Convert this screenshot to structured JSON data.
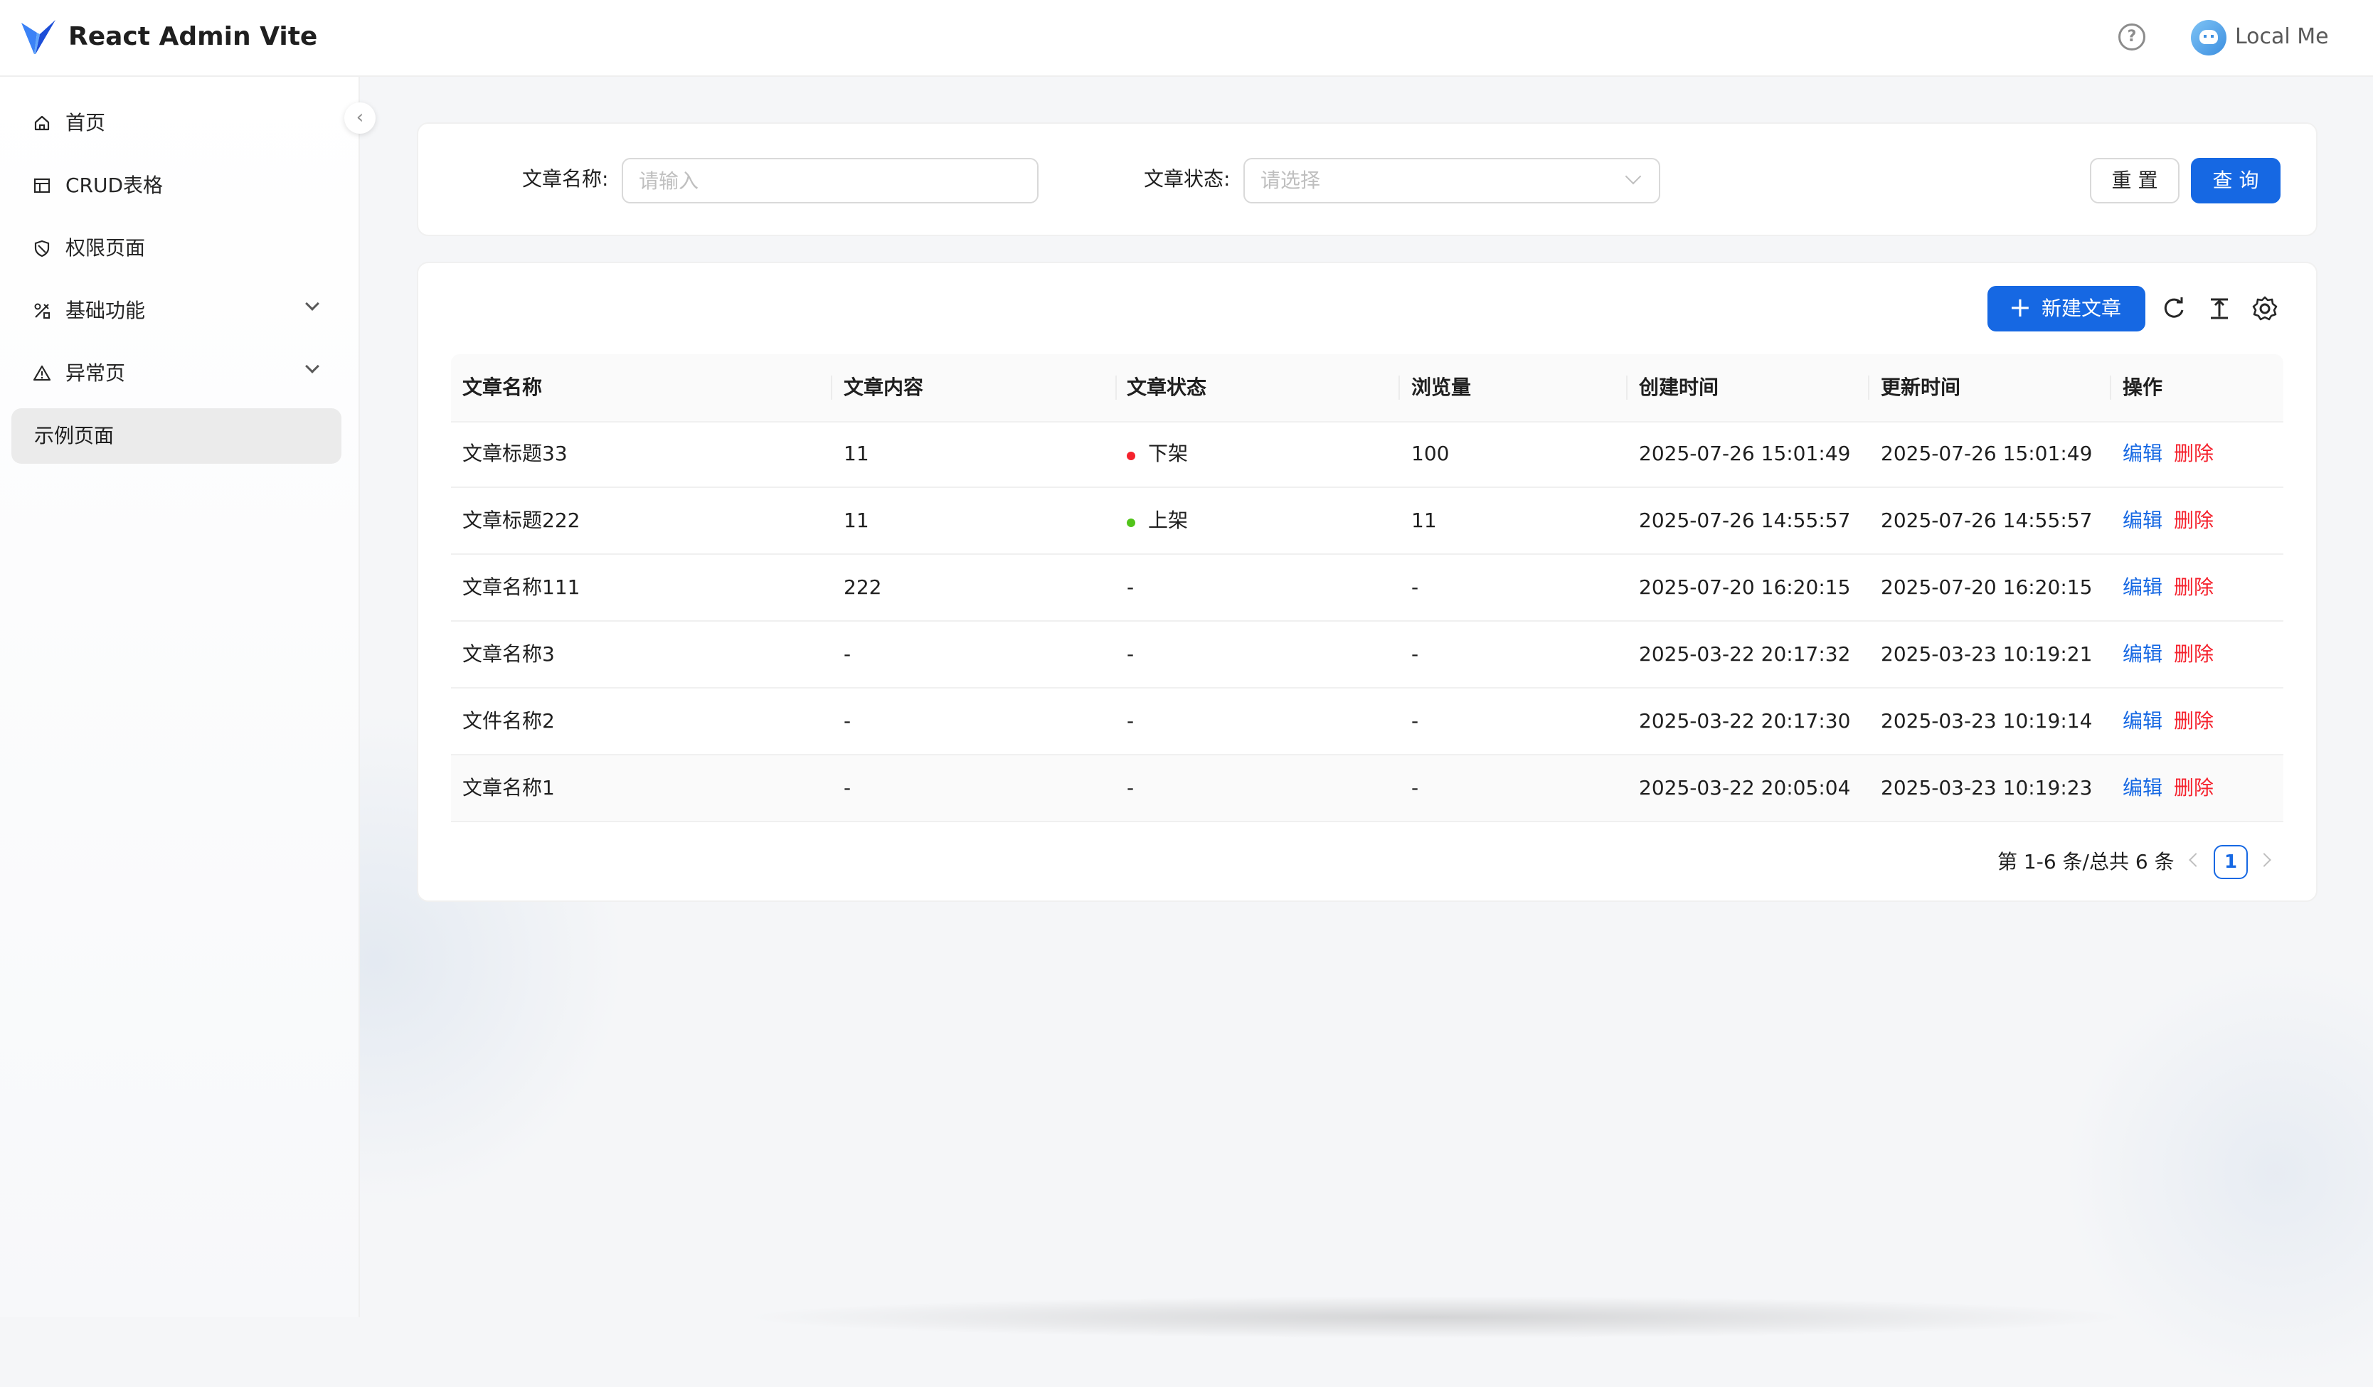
{
  "header": {
    "app_title": "React Admin Vite",
    "user_name": "Local Me",
    "help_icon": "?"
  },
  "sidebar": {
    "collapse_icon": "‹",
    "items": [
      {
        "label": "首页",
        "icon": "home-icon"
      },
      {
        "label": "CRUD表格",
        "icon": "table-icon"
      },
      {
        "label": "权限页面",
        "icon": "shield-icon"
      },
      {
        "label": "基础功能",
        "icon": "tools-icon",
        "expandable": true
      },
      {
        "label": "异常页",
        "icon": "warning-icon",
        "expandable": true
      },
      {
        "label": "示例页面",
        "active": true
      }
    ]
  },
  "search": {
    "name_label": "文章名称:",
    "name_placeholder": "请输入",
    "status_label": "文章状态:",
    "status_placeholder": "请选择",
    "reset_label": "重 置",
    "query_label": "查 询"
  },
  "toolbar": {
    "new_label": "新建文章",
    "new_icon": "+",
    "icons": [
      "refresh-icon",
      "density-icon",
      "settings-icon"
    ]
  },
  "table": {
    "columns": [
      "文章名称",
      "文章内容",
      "文章状态",
      "浏览量",
      "创建时间",
      "更新时间",
      "操作"
    ],
    "edit_label": "编辑",
    "delete_label": "删除",
    "rows": [
      {
        "name": "文章标题33",
        "content": "11",
        "status": "下架",
        "status_color": "#f5222d",
        "views": "100",
        "created": "2025-07-26 15:01:49",
        "updated": "2025-07-26 15:01:49"
      },
      {
        "name": "文章标题222",
        "content": "11",
        "status": "上架",
        "status_color": "#52c41a",
        "views": "11",
        "created": "2025-07-26 14:55:57",
        "updated": "2025-07-26 14:55:57"
      },
      {
        "name": "文章名称111",
        "content": "222",
        "status": "-",
        "status_color": "",
        "views": "-",
        "created": "2025-07-20 16:20:15",
        "updated": "2025-07-20 16:20:15"
      },
      {
        "name": "文章名称3",
        "content": "-",
        "status": "-",
        "status_color": "",
        "views": "-",
        "created": "2025-03-22 20:17:32",
        "updated": "2025-03-23 10:19:21"
      },
      {
        "name": "文件名称2",
        "content": "-",
        "status": "-",
        "status_color": "",
        "views": "-",
        "created": "2025-03-22 20:17:30",
        "updated": "2025-03-23 10:19:14"
      },
      {
        "name": "文章名称1",
        "content": "-",
        "status": "-",
        "status_color": "",
        "views": "-",
        "created": "2025-03-22 20:05:04",
        "updated": "2025-03-23 10:19:23"
      }
    ]
  },
  "pagination": {
    "total_text": "第 1-6 条/总共 6 条",
    "current_page": "1"
  },
  "colors": {
    "primary": "#1668e3",
    "danger": "#f5222d",
    "success": "#52c41a"
  }
}
